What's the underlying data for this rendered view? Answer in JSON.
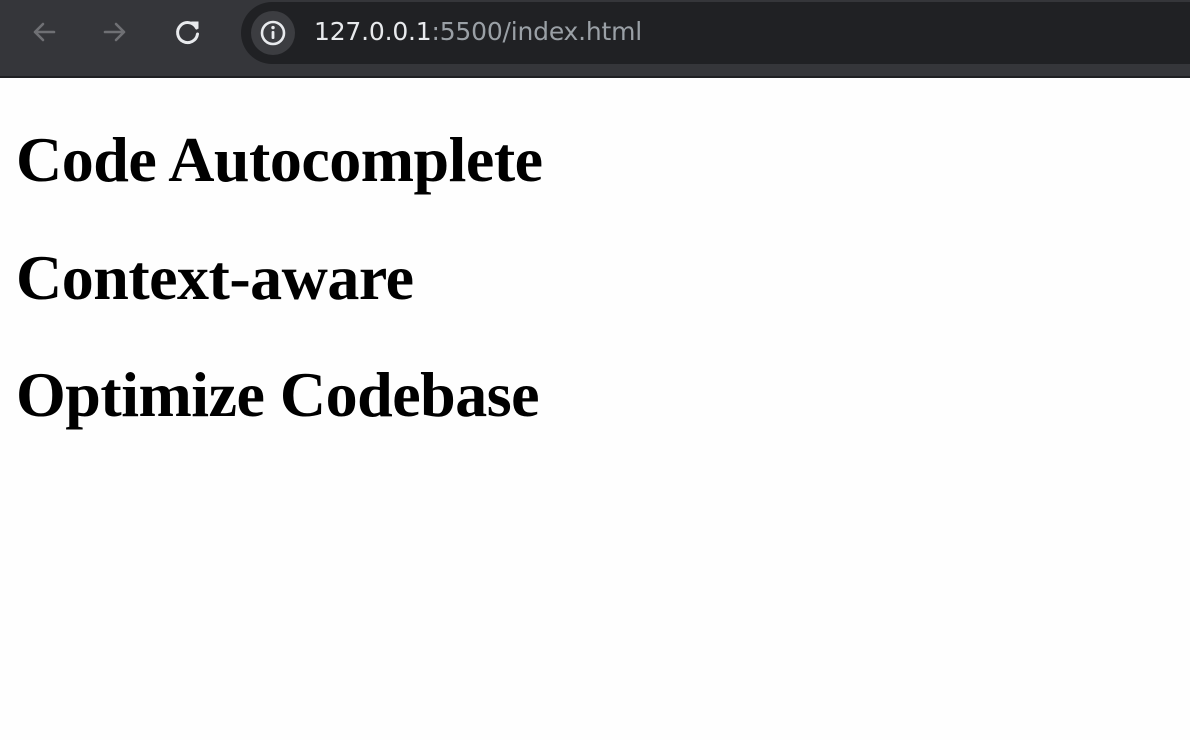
{
  "browser": {
    "url_host": "127.0.0.1",
    "url_rest": ":5500/index.html",
    "icons": {
      "back": "arrow-left-icon",
      "forward": "arrow-right-icon",
      "reload": "reload-icon",
      "site_info": "info-icon"
    },
    "colors": {
      "toolbar": "#35363a",
      "omnibox": "#202124",
      "url_host": "#e8eaed",
      "url_rest": "#9aa0a6"
    }
  },
  "page": {
    "headings": [
      "Code Autocomplete",
      "Context-aware",
      "Optimize Codebase"
    ]
  }
}
